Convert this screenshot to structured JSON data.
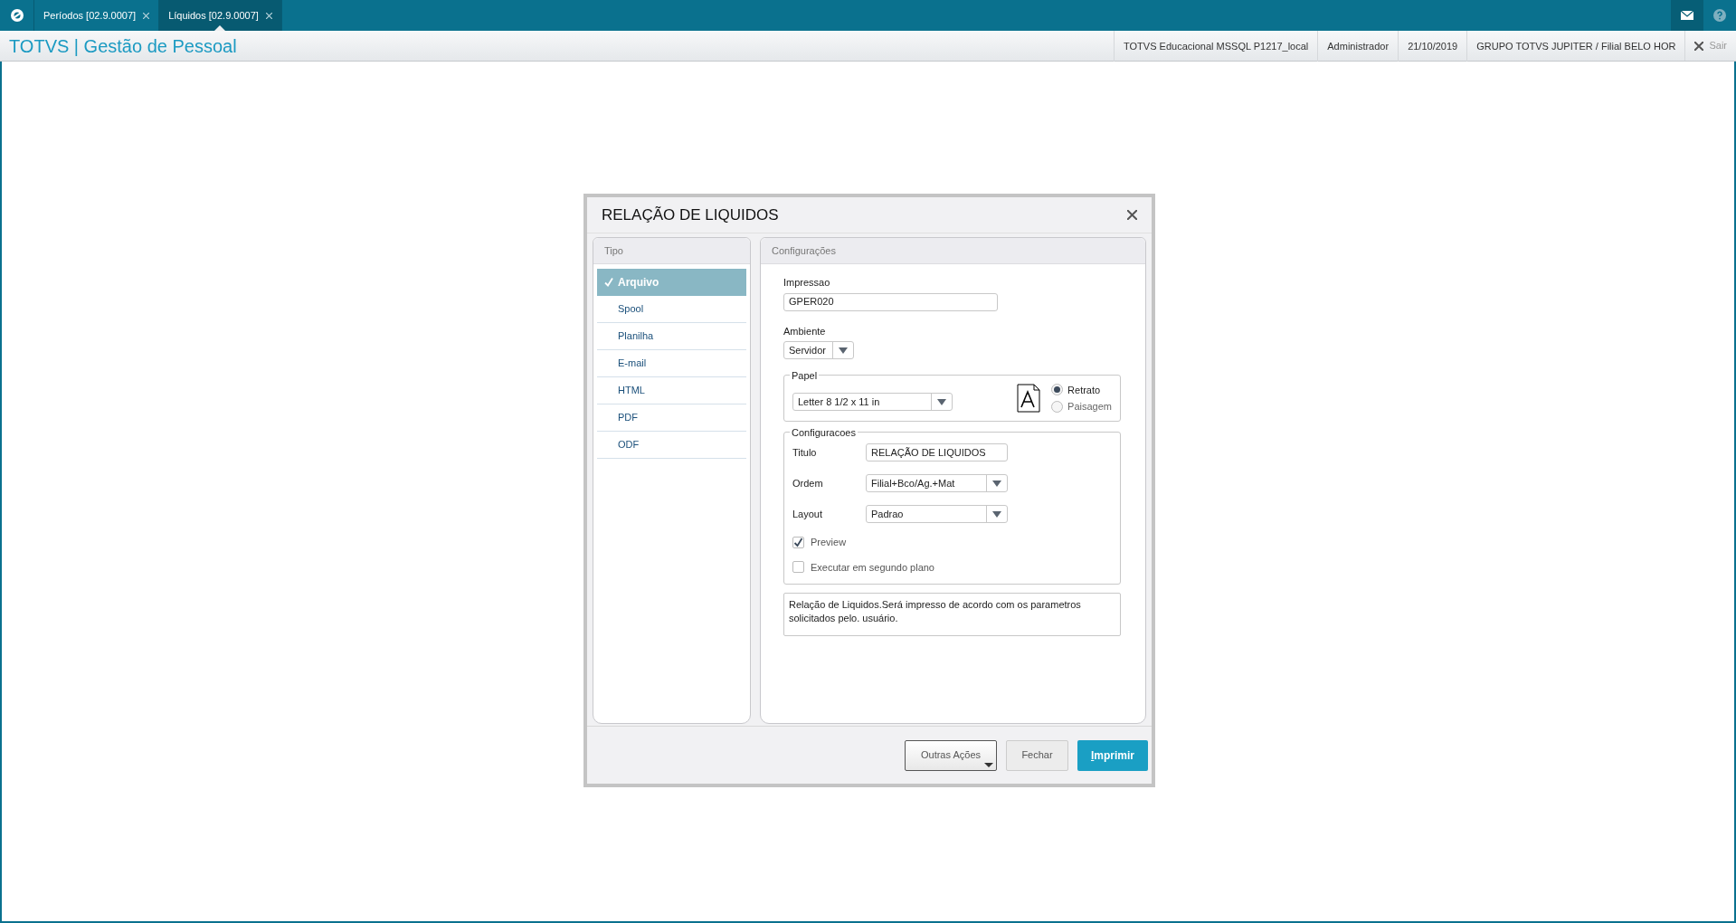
{
  "tabs": [
    {
      "label": "Períodos [02.9.0007]",
      "selected": false
    },
    {
      "label": "Líquidos [02.9.0007]",
      "selected": true
    }
  ],
  "app_title": "TOTVS | Gestão de Pessoal",
  "header_info": [
    "TOTVS Educacional MSSQL P1217_local",
    "Administrador",
    "21/10/2019",
    "GRUPO TOTVS JUPITER / Filial BELO HOR"
  ],
  "exit_label": "Sair",
  "dialog": {
    "title": "RELAÇÃO DE LIQUIDOS",
    "tipo": {
      "heading": "Tipo",
      "items": [
        {
          "label": "Arquivo",
          "selected": true
        },
        {
          "label": "Spool",
          "selected": false
        },
        {
          "label": "Planilha",
          "selected": false
        },
        {
          "label": "E-mail",
          "selected": false
        },
        {
          "label": "HTML",
          "selected": false
        },
        {
          "label": "PDF",
          "selected": false
        },
        {
          "label": "ODF",
          "selected": false
        }
      ]
    },
    "config": {
      "heading": "Configurações",
      "impressao": {
        "label": "Impressao",
        "value": "GPER020"
      },
      "ambiente": {
        "label": "Ambiente",
        "value": "Servidor"
      },
      "papel": {
        "legend": "Papel",
        "value": "Letter 8 1/2 x 11 in",
        "orientation": [
          {
            "label": "Retrato",
            "selected": true
          },
          {
            "label": "Paisagem",
            "selected": false
          }
        ]
      },
      "configuracoes": {
        "legend": "Configuracoes",
        "fields": [
          {
            "kind": "text",
            "label": "Titulo",
            "value": "RELAÇÃO DE LIQUIDOS"
          },
          {
            "kind": "select",
            "label": "Ordem",
            "value": "Filial+Bco/Ag.+Mat"
          },
          {
            "kind": "select",
            "label": "Layout",
            "value": "Padrao"
          }
        ],
        "checks": [
          {
            "label": "Preview",
            "checked": true
          },
          {
            "label": "Executar em segundo plano",
            "checked": false
          }
        ]
      },
      "description": "Relação de Liquidos.Será impresso de acordo com os parametros solicitados pelo. usuário."
    },
    "buttons": {
      "other": "Outras Ações",
      "close": "Fechar",
      "print": "Imprimir"
    }
  }
}
